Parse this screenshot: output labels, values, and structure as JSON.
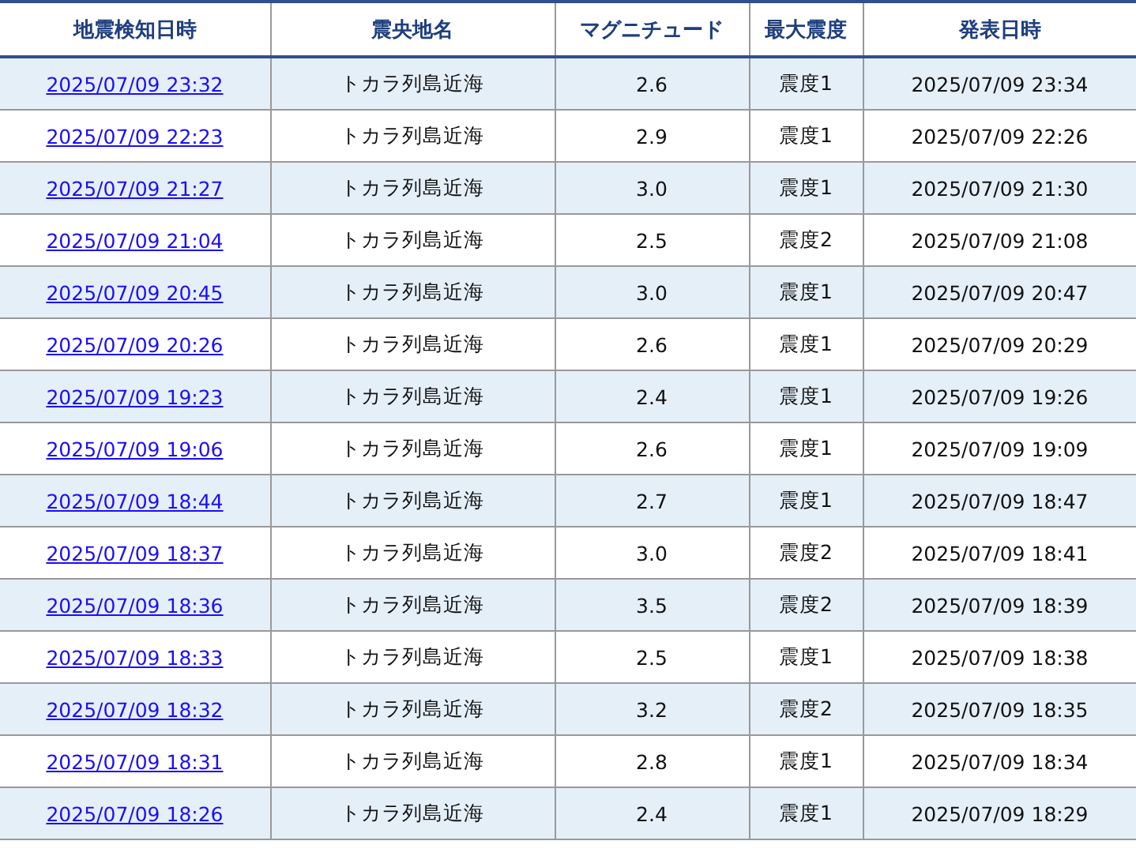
{
  "table": {
    "columns": [
      "地震検知日時",
      "震央地名",
      "マグニチュード",
      "最大震度",
      "発表日時"
    ],
    "rows": [
      {
        "detected": "2025/07/09 23:32",
        "region": "トカラ列島近海",
        "magnitude": "2.6",
        "intensity": "震度1",
        "announced": "2025/07/09 23:34"
      },
      {
        "detected": "2025/07/09 22:23",
        "region": "トカラ列島近海",
        "magnitude": "2.9",
        "intensity": "震度1",
        "announced": "2025/07/09 22:26"
      },
      {
        "detected": "2025/07/09 21:27",
        "region": "トカラ列島近海",
        "magnitude": "3.0",
        "intensity": "震度1",
        "announced": "2025/07/09 21:30"
      },
      {
        "detected": "2025/07/09 21:04",
        "region": "トカラ列島近海",
        "magnitude": "2.5",
        "intensity": "震度2",
        "announced": "2025/07/09 21:08"
      },
      {
        "detected": "2025/07/09 20:45",
        "region": "トカラ列島近海",
        "magnitude": "3.0",
        "intensity": "震度1",
        "announced": "2025/07/09 20:47"
      },
      {
        "detected": "2025/07/09 20:26",
        "region": "トカラ列島近海",
        "magnitude": "2.6",
        "intensity": "震度1",
        "announced": "2025/07/09 20:29"
      },
      {
        "detected": "2025/07/09 19:23",
        "region": "トカラ列島近海",
        "magnitude": "2.4",
        "intensity": "震度1",
        "announced": "2025/07/09 19:26"
      },
      {
        "detected": "2025/07/09 19:06",
        "region": "トカラ列島近海",
        "magnitude": "2.6",
        "intensity": "震度1",
        "announced": "2025/07/09 19:09"
      },
      {
        "detected": "2025/07/09 18:44",
        "region": "トカラ列島近海",
        "magnitude": "2.7",
        "intensity": "震度1",
        "announced": "2025/07/09 18:47"
      },
      {
        "detected": "2025/07/09 18:37",
        "region": "トカラ列島近海",
        "magnitude": "3.0",
        "intensity": "震度2",
        "announced": "2025/07/09 18:41"
      },
      {
        "detected": "2025/07/09 18:36",
        "region": "トカラ列島近海",
        "magnitude": "3.5",
        "intensity": "震度2",
        "announced": "2025/07/09 18:39"
      },
      {
        "detected": "2025/07/09 18:33",
        "region": "トカラ列島近海",
        "magnitude": "2.5",
        "intensity": "震度1",
        "announced": "2025/07/09 18:38"
      },
      {
        "detected": "2025/07/09 18:32",
        "region": "トカラ列島近海",
        "magnitude": "3.2",
        "intensity": "震度2",
        "announced": "2025/07/09 18:35"
      },
      {
        "detected": "2025/07/09 18:31",
        "region": "トカラ列島近海",
        "magnitude": "2.8",
        "intensity": "震度1",
        "announced": "2025/07/09 18:34"
      },
      {
        "detected": "2025/07/09 18:26",
        "region": "トカラ列島近海",
        "magnitude": "2.4",
        "intensity": "震度1",
        "announced": "2025/07/09 18:29"
      }
    ]
  }
}
